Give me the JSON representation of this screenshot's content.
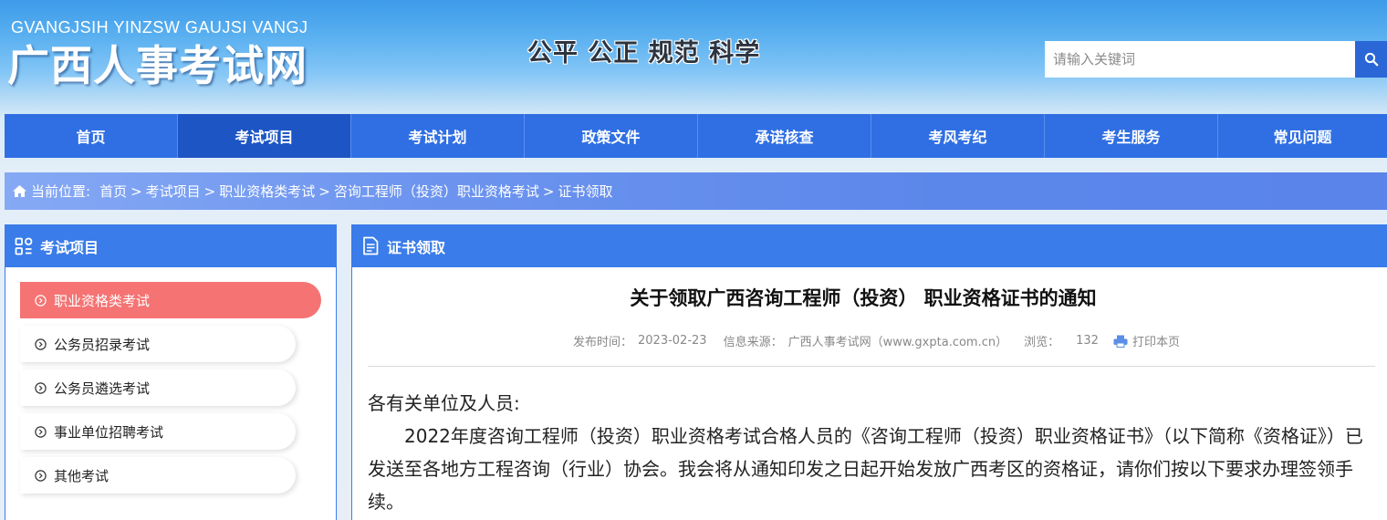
{
  "header": {
    "logo_pinyin": "GVANGJSIH YINZSW GAUJSI VANGJ",
    "logo_cn": "广西人事考试网",
    "slogan": "公平 公正 规范 科学",
    "search_placeholder": "请输入关键词",
    "search_icon": "search-icon"
  },
  "nav": {
    "items": [
      {
        "label": "首页"
      },
      {
        "label": "考试项目"
      },
      {
        "label": "考试计划"
      },
      {
        "label": "政策文件"
      },
      {
        "label": "承诺核查"
      },
      {
        "label": "考风考纪"
      },
      {
        "label": "考生服务"
      },
      {
        "label": "常见问题"
      }
    ],
    "active_index": 1
  },
  "breadcrumb": {
    "label": "当前位置:",
    "items": [
      "首页",
      "考试项目",
      "职业资格类考试",
      "咨询工程师（投资）职业资格考试",
      "证书领取"
    ],
    "separator": ">"
  },
  "sidebar": {
    "title": "考试项目",
    "items": [
      {
        "label": "职业资格类考试"
      },
      {
        "label": "公务员招录考试"
      },
      {
        "label": "公务员遴选考试"
      },
      {
        "label": "事业单位招聘考试"
      },
      {
        "label": "其他考试"
      }
    ],
    "active_index": 0
  },
  "content": {
    "section_title": "证书领取",
    "article_title": "关于领取广西咨询工程师（投资） 职业资格证书的通知",
    "meta": {
      "publish_label": "发布时间：",
      "publish_date": "2023-02-23",
      "source_label": "信息来源：",
      "source": "广西人事考试网（www.gxpta.com.cn）",
      "views_label": "浏览：",
      "views": "132",
      "print_label": "打印本页"
    },
    "greeting": "各有关单位及人员:",
    "paragraph": "2022年度咨询工程师（投资）职业资格考试合格人员的《咨询工程师（投资）职业资格证书》（以下简称《资格证》）已发送至各地方工程咨询（行业）协会。我会将从通知印发之日起开始发放广西考区的资格证，请你们按以下要求办理签领手续。"
  },
  "colors": {
    "nav_bg": "#2f6fe3",
    "nav_active": "#1d55c5",
    "panel_head": "#3a7ce9",
    "side_active": "#f57373"
  }
}
